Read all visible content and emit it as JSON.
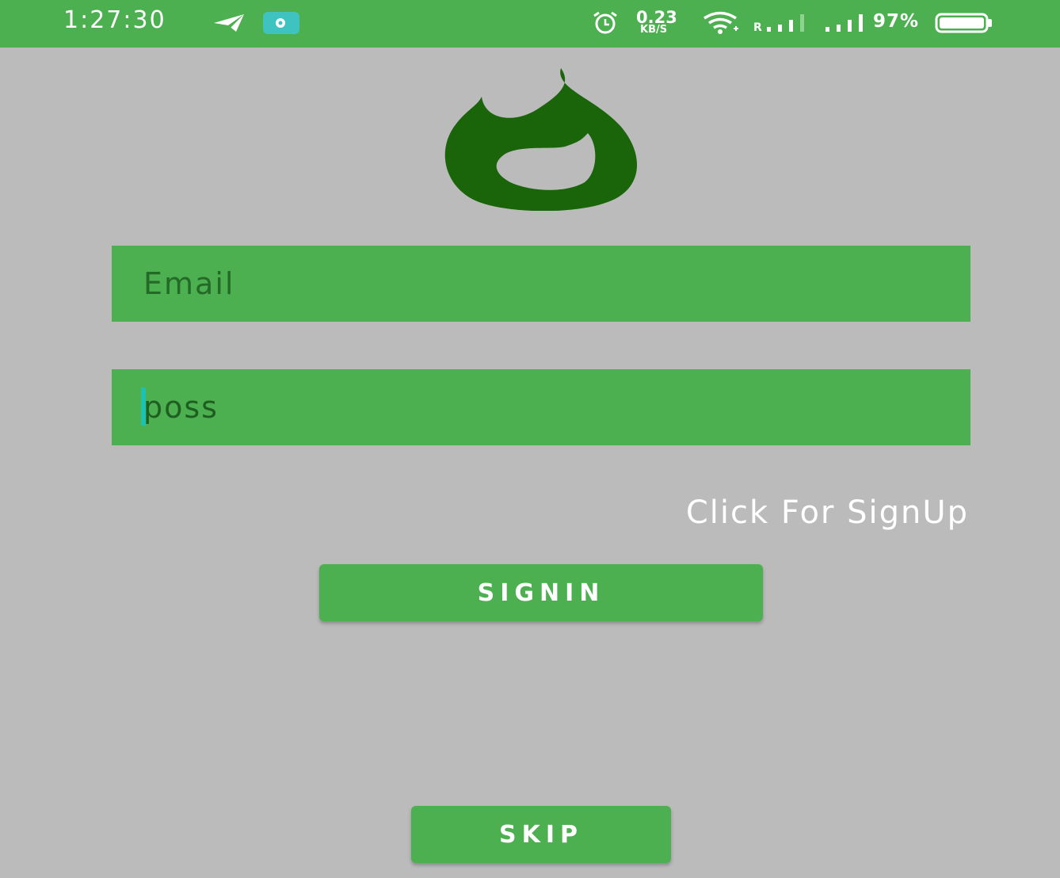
{
  "status_bar": {
    "time": "1:27:30",
    "speed_value": "0.23",
    "speed_unit": "KB/S",
    "roaming": "R",
    "battery": "97%",
    "icons": [
      "telegram-icon",
      "app-notification-icon",
      "alarm-icon",
      "wifi-icon",
      "signal-roaming-icon",
      "signal-icon",
      "battery-icon"
    ]
  },
  "logo": {
    "icon": "flame-logo-icon",
    "color": "#1a640a"
  },
  "form": {
    "email_placeholder": "Email",
    "password_value": "poss"
  },
  "signup_link": "Click For SignUp",
  "buttons": {
    "signin": "SIGNIN",
    "skip": "SKIP"
  },
  "colors": {
    "accent": "#4caf50",
    "background": "#bbbbbb",
    "field_text": "#1e5e21",
    "cursor": "#1fc1b0"
  }
}
